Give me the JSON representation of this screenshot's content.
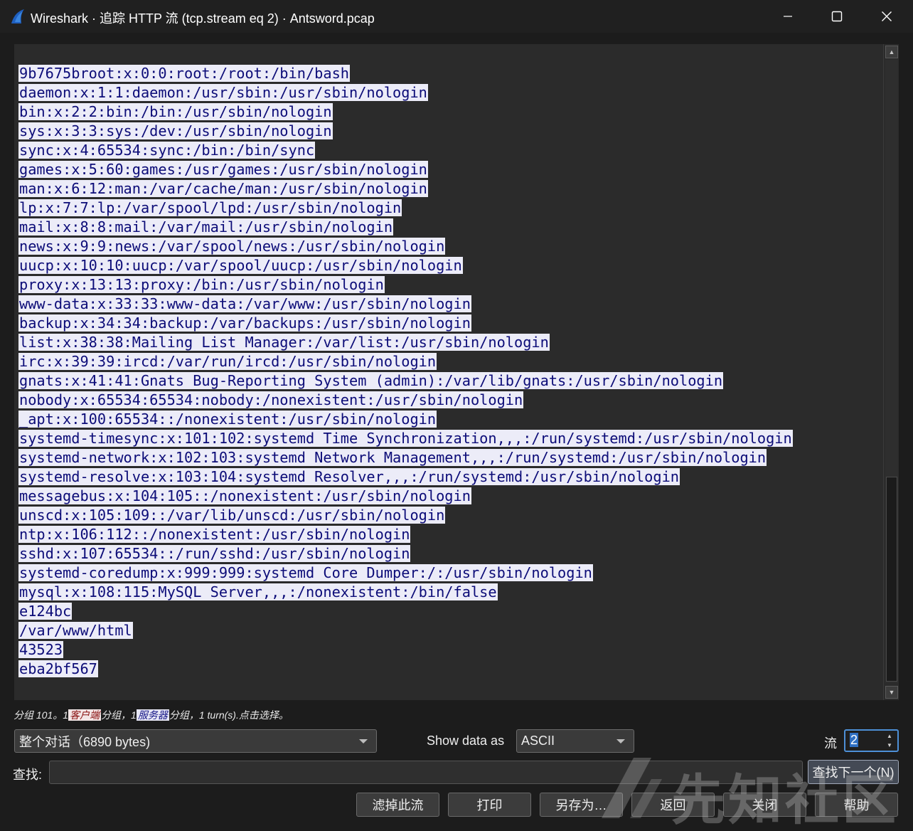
{
  "window": {
    "title": "Wireshark · 追踪 HTTP 流 (tcp.stream eq 2) · Antsword.pcap",
    "icon": "wireshark-fin-icon",
    "controls": {
      "minimize": "minimize-icon",
      "maximize": "maximize-icon",
      "close": "close-icon"
    }
  },
  "stream": {
    "lines": [
      "9b7675broot:x:0:0:root:/root:/bin/bash",
      "daemon:x:1:1:daemon:/usr/sbin:/usr/sbin/nologin",
      "bin:x:2:2:bin:/bin:/usr/sbin/nologin",
      "sys:x:3:3:sys:/dev:/usr/sbin/nologin",
      "sync:x:4:65534:sync:/bin:/bin/sync",
      "games:x:5:60:games:/usr/games:/usr/sbin/nologin",
      "man:x:6:12:man:/var/cache/man:/usr/sbin/nologin",
      "lp:x:7:7:lp:/var/spool/lpd:/usr/sbin/nologin",
      "mail:x:8:8:mail:/var/mail:/usr/sbin/nologin",
      "news:x:9:9:news:/var/spool/news:/usr/sbin/nologin",
      "uucp:x:10:10:uucp:/var/spool/uucp:/usr/sbin/nologin",
      "proxy:x:13:13:proxy:/bin:/usr/sbin/nologin",
      "www-data:x:33:33:www-data:/var/www:/usr/sbin/nologin",
      "backup:x:34:34:backup:/var/backups:/usr/sbin/nologin",
      "list:x:38:38:Mailing List Manager:/var/list:/usr/sbin/nologin",
      "irc:x:39:39:ircd:/var/run/ircd:/usr/sbin/nologin",
      "gnats:x:41:41:Gnats Bug-Reporting System (admin):/var/lib/gnats:/usr/sbin/nologin",
      "nobody:x:65534:65534:nobody:/nonexistent:/usr/sbin/nologin",
      "_apt:x:100:65534::/nonexistent:/usr/sbin/nologin",
      "systemd-timesync:x:101:102:systemd Time Synchronization,,,:/run/systemd:/usr/sbin/nologin",
      "systemd-network:x:102:103:systemd Network Management,,,:/run/systemd:/usr/sbin/nologin",
      "systemd-resolve:x:103:104:systemd Resolver,,,:/run/systemd:/usr/sbin/nologin",
      "messagebus:x:104:105::/nonexistent:/usr/sbin/nologin",
      "unscd:x:105:109::/var/lib/unscd:/usr/sbin/nologin",
      "ntp:x:106:112::/nonexistent:/usr/sbin/nologin",
      "sshd:x:107:65534::/run/sshd:/usr/sbin/nologin",
      "systemd-coredump:x:999:999:systemd Core Dumper:/:/usr/sbin/nologin",
      "mysql:x:108:115:MySQL Server,,,:/nonexistent:/bin/false",
      "e124bc",
      "/var/www/html",
      "43523",
      "eba2bf567"
    ],
    "colors": {
      "server_text": "#0c0c78",
      "server_bg": "#ececf8",
      "client_text": "#8a1010",
      "client_bg": "#f3e6e6"
    }
  },
  "status": {
    "prefix": "分组 101。1",
    "client_tag": "客户端",
    "mid": "分组，1",
    "server_tag": "服务器",
    "suffix": "分组，1 turn(s).点击选择。"
  },
  "controls": {
    "conversation": "整个对话（6890 bytes)",
    "show_data_as_label": "Show data as",
    "show_data_as_value": "ASCII",
    "stream_label": "流",
    "stream_value": "2",
    "find_label": "查找:",
    "find_value": "",
    "find_next_label": "查找下一个(N)"
  },
  "buttons": {
    "filter_out": "滤掉此流",
    "print": "打印",
    "save_as": "另存为…",
    "back": "返回",
    "close": "关闭",
    "help": "帮助"
  },
  "watermark": {
    "text": "先知社区"
  }
}
